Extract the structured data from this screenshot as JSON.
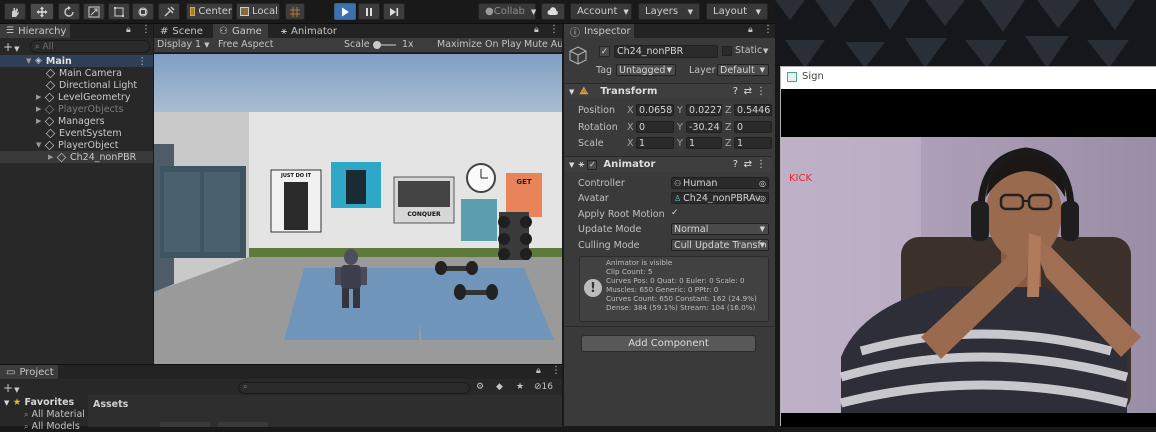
{
  "toolbar": {
    "pivot_label": "Center",
    "space_label": "Local",
    "collab_label": "Collab",
    "account_label": "Account",
    "layers_label": "Layers",
    "layout_label": "Layout"
  },
  "hierarchy": {
    "tab": "Hierarchy",
    "search_placeholder": "All",
    "scene": "Main",
    "items": [
      "Main Camera",
      "Directional Light",
      "LevelGeometry",
      "PlayerObjects",
      "Managers",
      "EventSystem",
      "PlayerObject",
      "Ch24_nonPBR"
    ]
  },
  "scene_tabs": {
    "scene": "Scene",
    "game": "Game",
    "animator": "Animator"
  },
  "game_bar": {
    "display": "Display 1",
    "aspect": "Free Aspect",
    "scale_label": "Scale",
    "scale_value": "1x",
    "maximize": "Maximize On Play",
    "mute": "Mute Au"
  },
  "game_view": {
    "posters": [
      "JUST DO IT",
      "CONQUER",
      "GET"
    ]
  },
  "inspector": {
    "tab": "Inspector",
    "object_name": "Ch24_nonPBR",
    "static_label": "Static",
    "tag_label": "Tag",
    "tag_value": "Untagged",
    "layer_label": "Layer",
    "layer_value": "Default",
    "transform": {
      "title": "Transform",
      "position_label": "Position",
      "rotation_label": "Rotation",
      "scale_label": "Scale",
      "position": [
        "0.0658",
        "0.0227",
        "0.5446"
      ],
      "rotation": [
        "0",
        "-30.24",
        "0"
      ],
      "scale": [
        "1",
        "1",
        "1"
      ]
    },
    "animator": {
      "title": "Animator",
      "controller_label": "Controller",
      "controller_value": "Human",
      "avatar_label": "Avatar",
      "avatar_value": "Ch24_nonPBRAv",
      "root_motion_label": "Apply Root Motion",
      "update_mode_label": "Update Mode",
      "update_mode_value": "Normal",
      "culling_mode_label": "Culling Mode",
      "culling_mode_value": "Cull Update Transfo",
      "info": [
        "Animator is visible",
        "Clip Count: 5",
        "Curves Pos: 0 Quat: 0 Euler: 0 Scale: 0",
        "Muscles: 650 Generic: 0 PPtr: 0",
        "Curves Count: 650 Constant: 162 (24.9%)",
        "Dense: 384 (59.1%) Stream: 104 (16.0%)"
      ]
    },
    "add_component": "Add Component"
  },
  "project": {
    "tab": "Project",
    "count": "16",
    "favorites": "Favorites",
    "fav_items": [
      "All Material",
      "All Models"
    ],
    "assets": "Assets"
  },
  "sign_window": {
    "title": "Sign",
    "label": "KICK"
  },
  "colors": {
    "accent_blue": "#3a72b0",
    "kick_red": "#e0262a"
  }
}
